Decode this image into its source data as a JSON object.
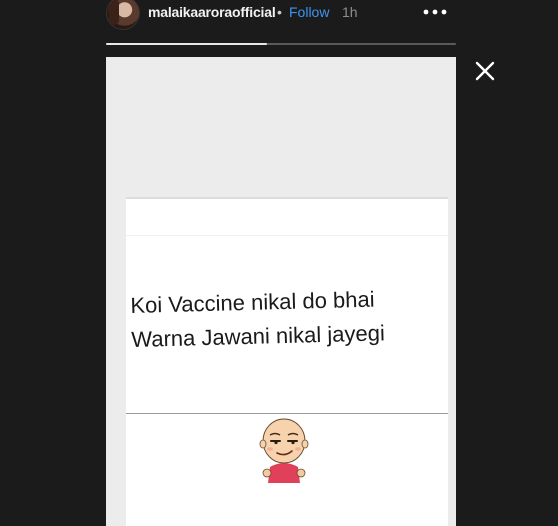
{
  "header": {
    "username": "malaikaaroraofficial",
    "separator": "•",
    "follow_label": "Follow",
    "time_ago": "1h",
    "more_icon": "more-horizontal-icon",
    "close_icon": "close-icon"
  },
  "progress": {
    "segments": 2,
    "current_segment": 1,
    "fill_fraction": 0.46
  },
  "story": {
    "meme_lines": [
      "Koi Vaccine nikal do bhai",
      "Warna Jawani nikal jayegi"
    ],
    "sticker": "smirking-cartoon-boy"
  },
  "colors": {
    "background": "#1b1b1b",
    "follow_blue": "#3d95ef",
    "story_bg": "#ececec"
  }
}
